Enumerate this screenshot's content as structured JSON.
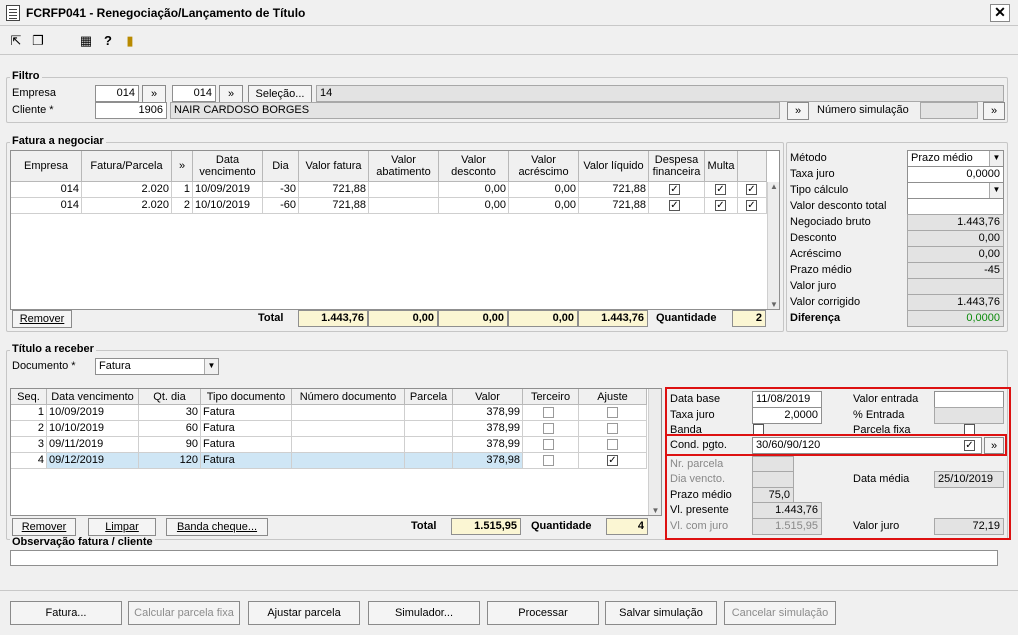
{
  "window": {
    "title": "FCRFP041 - Renegociação/Lançamento de Título",
    "close": "✕"
  },
  "filtro": {
    "label": "Filtro",
    "empresa_label": "Empresa",
    "empresa_value": "014",
    "empresa2_value": "014",
    "selecao_btn": "Seleção...",
    "selecao_value": "14",
    "cliente_label": "Cliente *",
    "cliente_code": "1906",
    "cliente_name": "NAIR CARDOSO BORGES",
    "num_sim_label": "Número simulação",
    "num_sim_value": ""
  },
  "fatura": {
    "label": "Fatura a negociar",
    "columns": [
      "Empresa",
      "Fatura/Parcela",
      "»",
      "Data vencimento",
      "Dia",
      "Valor fatura",
      "Valor abatimento",
      "Valor desconto",
      "Valor acréscimo",
      "Valor líquido",
      "Despesa financeira",
      "Multa",
      ""
    ],
    "rows": [
      {
        "empresa": "014",
        "fatura": "2.020",
        "parcela": "1",
        "data": "10/09/2019",
        "dia": "-30",
        "valor": "721,88",
        "abat": "",
        "desc": "0,00",
        "acresc": "0,00",
        "liquido": "721,88"
      },
      {
        "empresa": "014",
        "fatura": "2.020",
        "parcela": "2",
        "data": "10/10/2019",
        "dia": "-60",
        "valor": "721,88",
        "abat": "",
        "desc": "0,00",
        "acresc": "0,00",
        "liquido": "721,88"
      }
    ],
    "remover_btn": "Remover",
    "total_label": "Total",
    "totals": {
      "valor": "1.443,76",
      "abat": "0,00",
      "desc": "0,00",
      "acresc": "0,00",
      "liquido": "1.443,76"
    },
    "quantidade_label": "Quantidade",
    "quantidade_value": "2"
  },
  "metodo": {
    "metodo_label": "Método",
    "metodo_value": "Prazo médio",
    "taxa_label": "Taxa juro",
    "taxa_value": "0,0000",
    "tipo_label": "Tipo cálculo",
    "tipo_value": "",
    "vdt_label": "Valor desconto total",
    "vdt_value": "",
    "neg_label": "Negociado bruto",
    "neg_value": "1.443,76",
    "desc_label": "Desconto",
    "desc_value": "0,00",
    "acr_label": "Acréscimo",
    "acr_value": "0,00",
    "pm_label": "Prazo médio",
    "pm_value": "-45",
    "vj_label": "Valor juro",
    "vj_value": "",
    "vc_label": "Valor corrigido",
    "vc_value": "1.443,76",
    "dif_label": "Diferença",
    "dif_value": "0,0000"
  },
  "titulo": {
    "label": "Título a receber",
    "doc_label": "Documento *",
    "doc_value": "Fatura",
    "columns": [
      "Seq.",
      "Data vencimento",
      "Qt. dia",
      "Tipo documento",
      "Número documento",
      "Parcela",
      "Valor",
      "Terceiro",
      "Ajuste"
    ],
    "rows": [
      {
        "seq": "1",
        "data": "10/09/2019",
        "qt": "30",
        "tipo": "Fatura",
        "valor": "378,99"
      },
      {
        "seq": "2",
        "data": "10/10/2019",
        "qt": "60",
        "tipo": "Fatura",
        "valor": "378,99"
      },
      {
        "seq": "3",
        "data": "09/11/2019",
        "qt": "90",
        "tipo": "Fatura",
        "valor": "378,99"
      },
      {
        "seq": "4",
        "data": "09/12/2019",
        "qt": "120",
        "tipo": "Fatura",
        "valor": "378,98"
      }
    ],
    "remover_btn": "Remover",
    "limpar_btn": "Limpar",
    "banda_btn": "Banda cheque...",
    "total_label": "Total",
    "total_value": "1.515,95",
    "quantidade_label": "Quantidade",
    "quantidade_value": "4"
  },
  "cond": {
    "data_base_label": "Data base",
    "data_base_value": "11/08/2019",
    "valor_entrada_label": "Valor entrada",
    "valor_entrada_value": "",
    "taxa_label": "Taxa juro",
    "taxa_value": "2,0000",
    "pct_entrada_label": "% Entrada",
    "pct_entrada_value": "",
    "banda_label": "Banda",
    "parcela_fixa_label": "Parcela fixa",
    "cond_label": "Cond. pgto.",
    "cond_value": "30/60/90/120",
    "nr_parcela_label": "Nr. parcela",
    "nr_parcela_value": "",
    "dia_vencto_label": "Dia vencto.",
    "dia_vencto_value": "",
    "data_media_label": "Data média",
    "data_media_value": "25/10/2019",
    "prazo_medio_label": "Prazo médio",
    "prazo_medio_value": "75,0",
    "vl_presente_label": "Vl. presente",
    "vl_presente_value": "1.443,76",
    "vl_juro_label": "Vl. com juro",
    "vl_juro_value": "1.515,95",
    "valor_juro_label": "Valor juro",
    "valor_juro_value": "72,19"
  },
  "obs": {
    "label": "Observação fatura / cliente",
    "value": ""
  },
  "footer": {
    "fatura": "Fatura...",
    "calcular": "Calcular parcela fixa",
    "ajustar": "Ajustar parcela",
    "simulador": "Simulador...",
    "processar": "Processar",
    "salvar": "Salvar simulação",
    "cancelar": "Cancelar simulação"
  }
}
